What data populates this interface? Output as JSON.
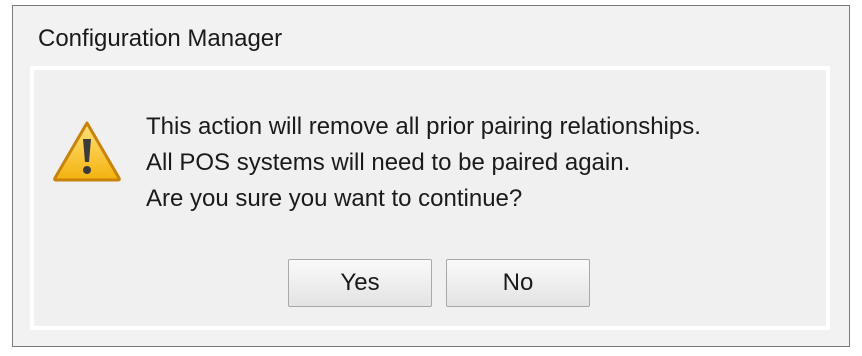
{
  "dialog": {
    "title": "Configuration Manager",
    "icon": "warning-icon",
    "message_lines": [
      "This action will remove all prior pairing relationships.",
      "All POS systems will need to be paired again.",
      "Are you sure you want to continue?"
    ],
    "buttons": {
      "yes_label": "Yes",
      "no_label": "No"
    }
  },
  "colors": {
    "warning_fill": "#f6c61b",
    "warning_border": "#c9830b",
    "dialog_background": "#f0f0f0"
  }
}
